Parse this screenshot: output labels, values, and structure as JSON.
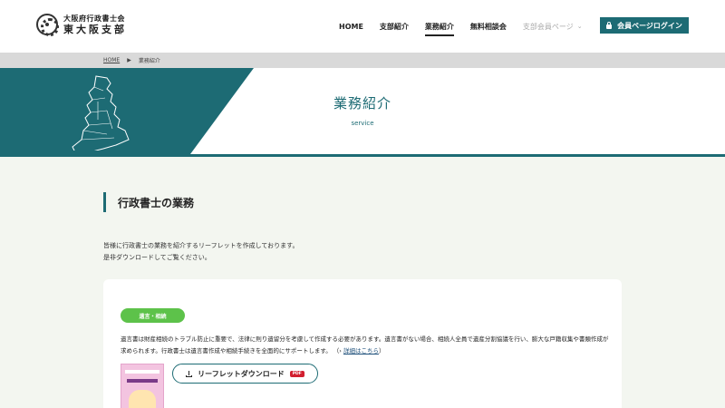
{
  "header": {
    "logo_line1": "大阪府行政書士会",
    "logo_line2": "東大阪支部",
    "nav": [
      {
        "label": "HOME"
      },
      {
        "label": "支部紹介"
      },
      {
        "label": "業務紹介",
        "active": true
      },
      {
        "label": "無料相談会"
      },
      {
        "label": "支部会員ページ"
      }
    ],
    "login_label": "会員ページログイン"
  },
  "breadcrumb": {
    "home": "HOME",
    "current": "業務紹介"
  },
  "hero": {
    "title": "業務紹介",
    "subtitle": "service"
  },
  "section": {
    "title": "行政書士の業務",
    "intro_line1": "皆様に行政書士の業務を紹介するリーフレットを作成しております。",
    "intro_line2": "是非ダウンロードしてご覧ください。"
  },
  "card": {
    "tag": "遺言・相続",
    "description": "遺言書は財産相続のトラブル防止に重要で、法律に則り遺留分を考慮して作成する必要があります。遺言書がない場合、相続人全員で遺産分割協議を行い、膨大な戸籍収集や書類作成が求められます。行政書士は遺言書作成や相続手続きを全面的にサポートします。",
    "detail_link": "詳細はこちら",
    "download_label": "リーフレットダウンロード",
    "pdf_badge": "PDF"
  },
  "colors": {
    "accent": "#1d6b74",
    "tag_green": "#5dc24a",
    "pdf_red": "#d21f2f",
    "page_bg": "#f3f6f0"
  }
}
